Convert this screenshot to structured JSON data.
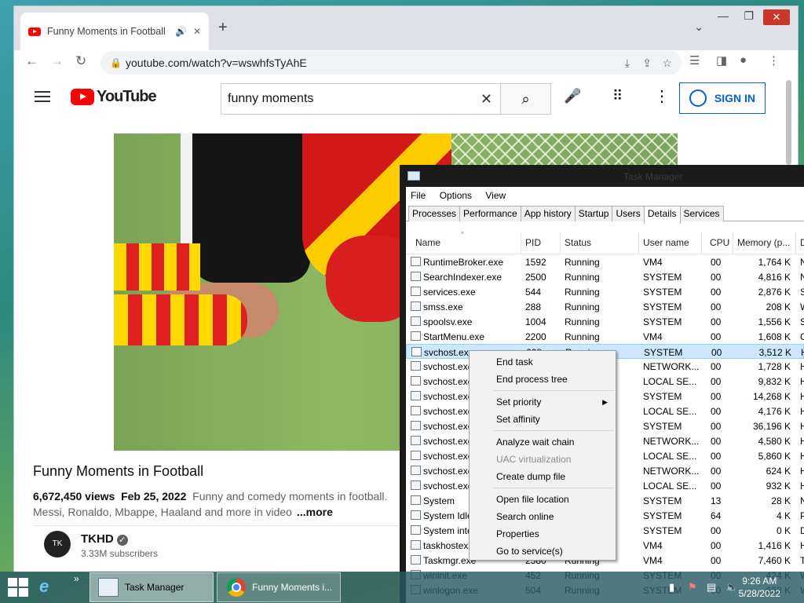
{
  "chrome": {
    "tab_title": "Funny Moments in Football",
    "url": "youtube.com/watch?v=wswhfsTyAhE"
  },
  "youtube": {
    "logo_text": "YouTube",
    "search_value": "funny moments",
    "sign_in_label": "SIGN IN",
    "video_title": "Funny Moments in Football",
    "views": "6,672,450 views",
    "date": "Feb 25, 2022",
    "description_line1": "Funny and comedy moments in football.",
    "description_line2": "Messi, Ronaldo, Mbappe, Haaland and more in video",
    "more_label": "...more",
    "channel_name": "TKHD",
    "channel_avatar": "TK",
    "subscribers": "3.33M subscribers"
  },
  "taskmgr": {
    "title": "Task Manager",
    "menu": [
      "File",
      "Options",
      "View"
    ],
    "tabs": [
      "Processes",
      "Performance",
      "App history",
      "Startup",
      "Users",
      "Details",
      "Services"
    ],
    "active_tab": "Details",
    "columns": [
      "Name",
      "PID",
      "Status",
      "User name",
      "CPU",
      "Memory (p...",
      "D"
    ],
    "rows": [
      {
        "name": "RuntimeBroker.exe",
        "pid": "1592",
        "status": "Running",
        "user": "VM4",
        "cpu": "00",
        "mem": "1,764 K",
        "d": "N"
      },
      {
        "name": "SearchIndexer.exe",
        "pid": "2500",
        "status": "Running",
        "user": "SYSTEM",
        "cpu": "00",
        "mem": "4,816 K",
        "d": "N"
      },
      {
        "name": "services.exe",
        "pid": "544",
        "status": "Running",
        "user": "SYSTEM",
        "cpu": "00",
        "mem": "2,876 K",
        "d": "S"
      },
      {
        "name": "smss.exe",
        "pid": "288",
        "status": "Running",
        "user": "SYSTEM",
        "cpu": "00",
        "mem": "208 K",
        "d": "W"
      },
      {
        "name": "spoolsv.exe",
        "pid": "1004",
        "status": "Running",
        "user": "SYSTEM",
        "cpu": "00",
        "mem": "1,556 K",
        "d": "S"
      },
      {
        "name": "StartMenu.exe",
        "pid": "2200",
        "status": "Running",
        "user": "VM4",
        "cpu": "00",
        "mem": "1,608 K",
        "d": "C"
      },
      {
        "name": "svchost.exe",
        "pid": "628",
        "status": "Running",
        "user": "SYSTEM",
        "cpu": "00",
        "mem": "3,512 K",
        "d": "H"
      },
      {
        "name": "svchost.exe",
        "pid": "",
        "status": "",
        "user": "NETWORK...",
        "cpu": "00",
        "mem": "1,728 K",
        "d": "H"
      },
      {
        "name": "svchost.exe",
        "pid": "",
        "status": "",
        "user": "LOCAL SE...",
        "cpu": "00",
        "mem": "9,832 K",
        "d": "H"
      },
      {
        "name": "svchost.exe",
        "pid": "",
        "status": "",
        "user": "SYSTEM",
        "cpu": "00",
        "mem": "14,268 K",
        "d": "H"
      },
      {
        "name": "svchost.exe",
        "pid": "",
        "status": "",
        "user": "LOCAL SE...",
        "cpu": "00",
        "mem": "4,176 K",
        "d": "H"
      },
      {
        "name": "svchost.exe",
        "pid": "",
        "status": "",
        "user": "SYSTEM",
        "cpu": "00",
        "mem": "36,196 K",
        "d": "H"
      },
      {
        "name": "svchost.exe",
        "pid": "",
        "status": "",
        "user": "NETWORK...",
        "cpu": "00",
        "mem": "4,580 K",
        "d": "H"
      },
      {
        "name": "svchost.exe",
        "pid": "",
        "status": "",
        "user": "LOCAL SE...",
        "cpu": "00",
        "mem": "5,860 K",
        "d": "H"
      },
      {
        "name": "svchost.exe",
        "pid": "",
        "status": "",
        "user": "NETWORK...",
        "cpu": "00",
        "mem": "624 K",
        "d": "H"
      },
      {
        "name": "svchost.exe",
        "pid": "",
        "status": "",
        "user": "LOCAL SE...",
        "cpu": "00",
        "mem": "932 K",
        "d": "H"
      },
      {
        "name": "System",
        "pid": "",
        "status": "",
        "user": "SYSTEM",
        "cpu": "13",
        "mem": "28 K",
        "d": "N"
      },
      {
        "name": "System Idle",
        "pid": "",
        "status": "",
        "user": "SYSTEM",
        "cpu": "64",
        "mem": "4 K",
        "d": "P"
      },
      {
        "name": "System inte",
        "pid": "",
        "status": "",
        "user": "SYSTEM",
        "cpu": "00",
        "mem": "0 K",
        "d": "D"
      },
      {
        "name": "taskhostex.",
        "pid": "",
        "status": "",
        "user": "VM4",
        "cpu": "00",
        "mem": "1,416 K",
        "d": "H"
      },
      {
        "name": "Taskmgr.exe",
        "pid": "2580",
        "status": "Running",
        "user": "VM4",
        "cpu": "00",
        "mem": "7,460 K",
        "d": "T"
      },
      {
        "name": "wininit.exe",
        "pid": "452",
        "status": "Running",
        "user": "SYSTEM",
        "cpu": "00",
        "mem": "424 K",
        "d": "W"
      },
      {
        "name": "winlogon.exe",
        "pid": "504",
        "status": "Running",
        "user": "SYSTEM",
        "cpu": "00",
        "mem": "668 K",
        "d": "W"
      }
    ]
  },
  "context_menu": [
    {
      "label": "End task"
    },
    {
      "label": "End process tree"
    },
    {
      "sep": true
    },
    {
      "label": "Set priority",
      "submenu": true
    },
    {
      "label": "Set affinity"
    },
    {
      "sep": true
    },
    {
      "label": "Analyze wait chain"
    },
    {
      "label": "UAC virtualization",
      "disabled": true
    },
    {
      "label": "Create dump file"
    },
    {
      "sep": true
    },
    {
      "label": "Open file location"
    },
    {
      "label": "Search online"
    },
    {
      "label": "Properties"
    },
    {
      "label": "Go to service(s)"
    }
  ],
  "taskbar": {
    "apps": [
      "Task Manager",
      "Funny Moments i..."
    ],
    "time": "9:26 AM",
    "date": "5/28/2022"
  }
}
